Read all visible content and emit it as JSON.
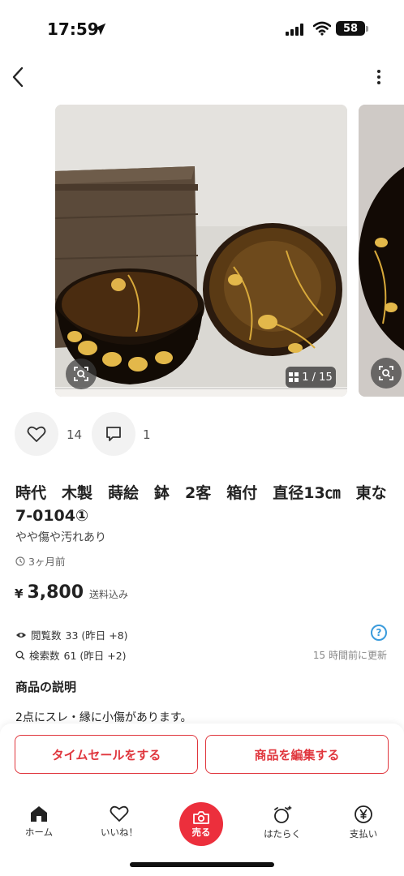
{
  "status_bar": {
    "time": "17:59",
    "battery": "58"
  },
  "gallery": {
    "counter": "1 / 15"
  },
  "likes": {
    "count": "14"
  },
  "comments": {
    "count": "1"
  },
  "item": {
    "title": "時代　木製　蒔絵　鉢　2客　箱付　直径13㎝　東な7-0104①",
    "condition": "やや傷や汚れあり",
    "posted": "3ヶ月前",
    "currency": "¥",
    "price": "3,800",
    "shipping": "送料込み"
  },
  "stats": {
    "views_label": "閲覧数",
    "views_value": "33 (昨日 +8)",
    "search_label": "検索数",
    "search_value": "61 (昨日 +2)",
    "help": "?",
    "updated": "15 時間前に更新"
  },
  "description": {
    "heading": "商品の説明",
    "text": "2点にスレ・縁に小傷があります。"
  },
  "actions": {
    "timesale": "タイムセールをする",
    "edit": "商品を編集する"
  },
  "tabs": {
    "home": "ホーム",
    "likes": "いいね！",
    "sell": "売る",
    "work": "はたらく",
    "pay": "支払い"
  },
  "colors": {
    "accent": "#e0363d",
    "sell": "#ec2f3c",
    "link": "#3a9bdc"
  }
}
